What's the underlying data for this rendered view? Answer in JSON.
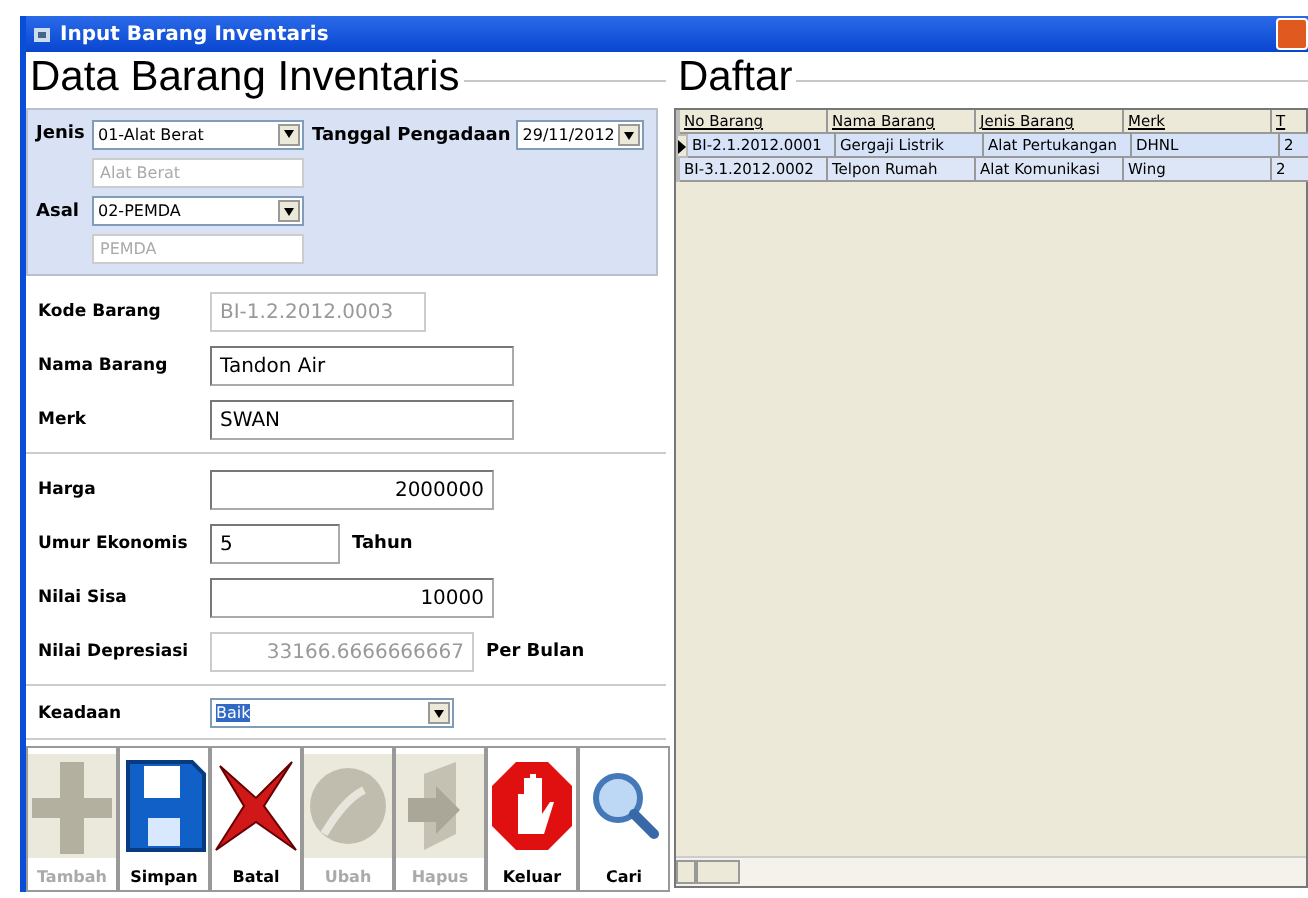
{
  "window": {
    "title": "Input Barang Inventaris"
  },
  "form": {
    "title": "Data Barang Inventaris",
    "jenis": {
      "label": "Jenis",
      "value": "01-Alat Berat",
      "description": "Alat Berat"
    },
    "tanggal": {
      "label": "Tanggal Pengadaan",
      "value": "29/11/2012"
    },
    "asal": {
      "label": "Asal",
      "value": "02-PEMDA",
      "description": "PEMDA"
    },
    "kode_barang": {
      "label": "Kode Barang",
      "value": "BI-1.2.2012.0003",
      "disabled": true
    },
    "nama_barang": {
      "label": "Nama Barang",
      "value": "Tandon Air",
      "disabled": false
    },
    "merk": {
      "label": "Merk",
      "value": "SWAN",
      "disabled": false
    },
    "harga": {
      "label": "Harga",
      "value": "2000000",
      "disabled": false
    },
    "umur": {
      "label": "Umur Ekonomis",
      "value": "5",
      "unit": "Tahun"
    },
    "nilai_sisa": {
      "label": "Nilai Sisa",
      "value": "10000",
      "disabled": false
    },
    "nilai_depresiasi": {
      "label": "Nilai Depresiasi",
      "value": "33166.6666666667",
      "unit": "Per Bulan",
      "disabled": true
    },
    "keadaan": {
      "label": "Keadaan",
      "value": "Baik"
    }
  },
  "toolbar": [
    {
      "kind": "plus",
      "label": "Tambah",
      "disabled": true
    },
    {
      "kind": "save",
      "label": "Simpan",
      "disabled": false
    },
    {
      "kind": "cancel",
      "label": "Batal",
      "disabled": false
    },
    {
      "kind": "edit",
      "label": "Ubah",
      "disabled": true
    },
    {
      "kind": "delete",
      "label": "Hapus",
      "disabled": true
    },
    {
      "kind": "exit",
      "label": "Keluar",
      "disabled": false
    },
    {
      "kind": "search",
      "label": "Cari",
      "disabled": false
    }
  ],
  "list": {
    "title": "Daftar",
    "columns": [
      "No Barang",
      "Nama Barang",
      "Jenis Barang",
      "Merk",
      "T"
    ],
    "rows": [
      {
        "selected": true,
        "cells": [
          "BI-2.1.2012.0001",
          "Gergaji Listrik",
          "Alat Pertukangan",
          "DHNL",
          "2"
        ]
      },
      {
        "selected": false,
        "cells": [
          "BI-3.1.2012.0002",
          "Telpon Rumah",
          "Alat Komunikasi",
          "Wing",
          "2"
        ]
      }
    ]
  }
}
